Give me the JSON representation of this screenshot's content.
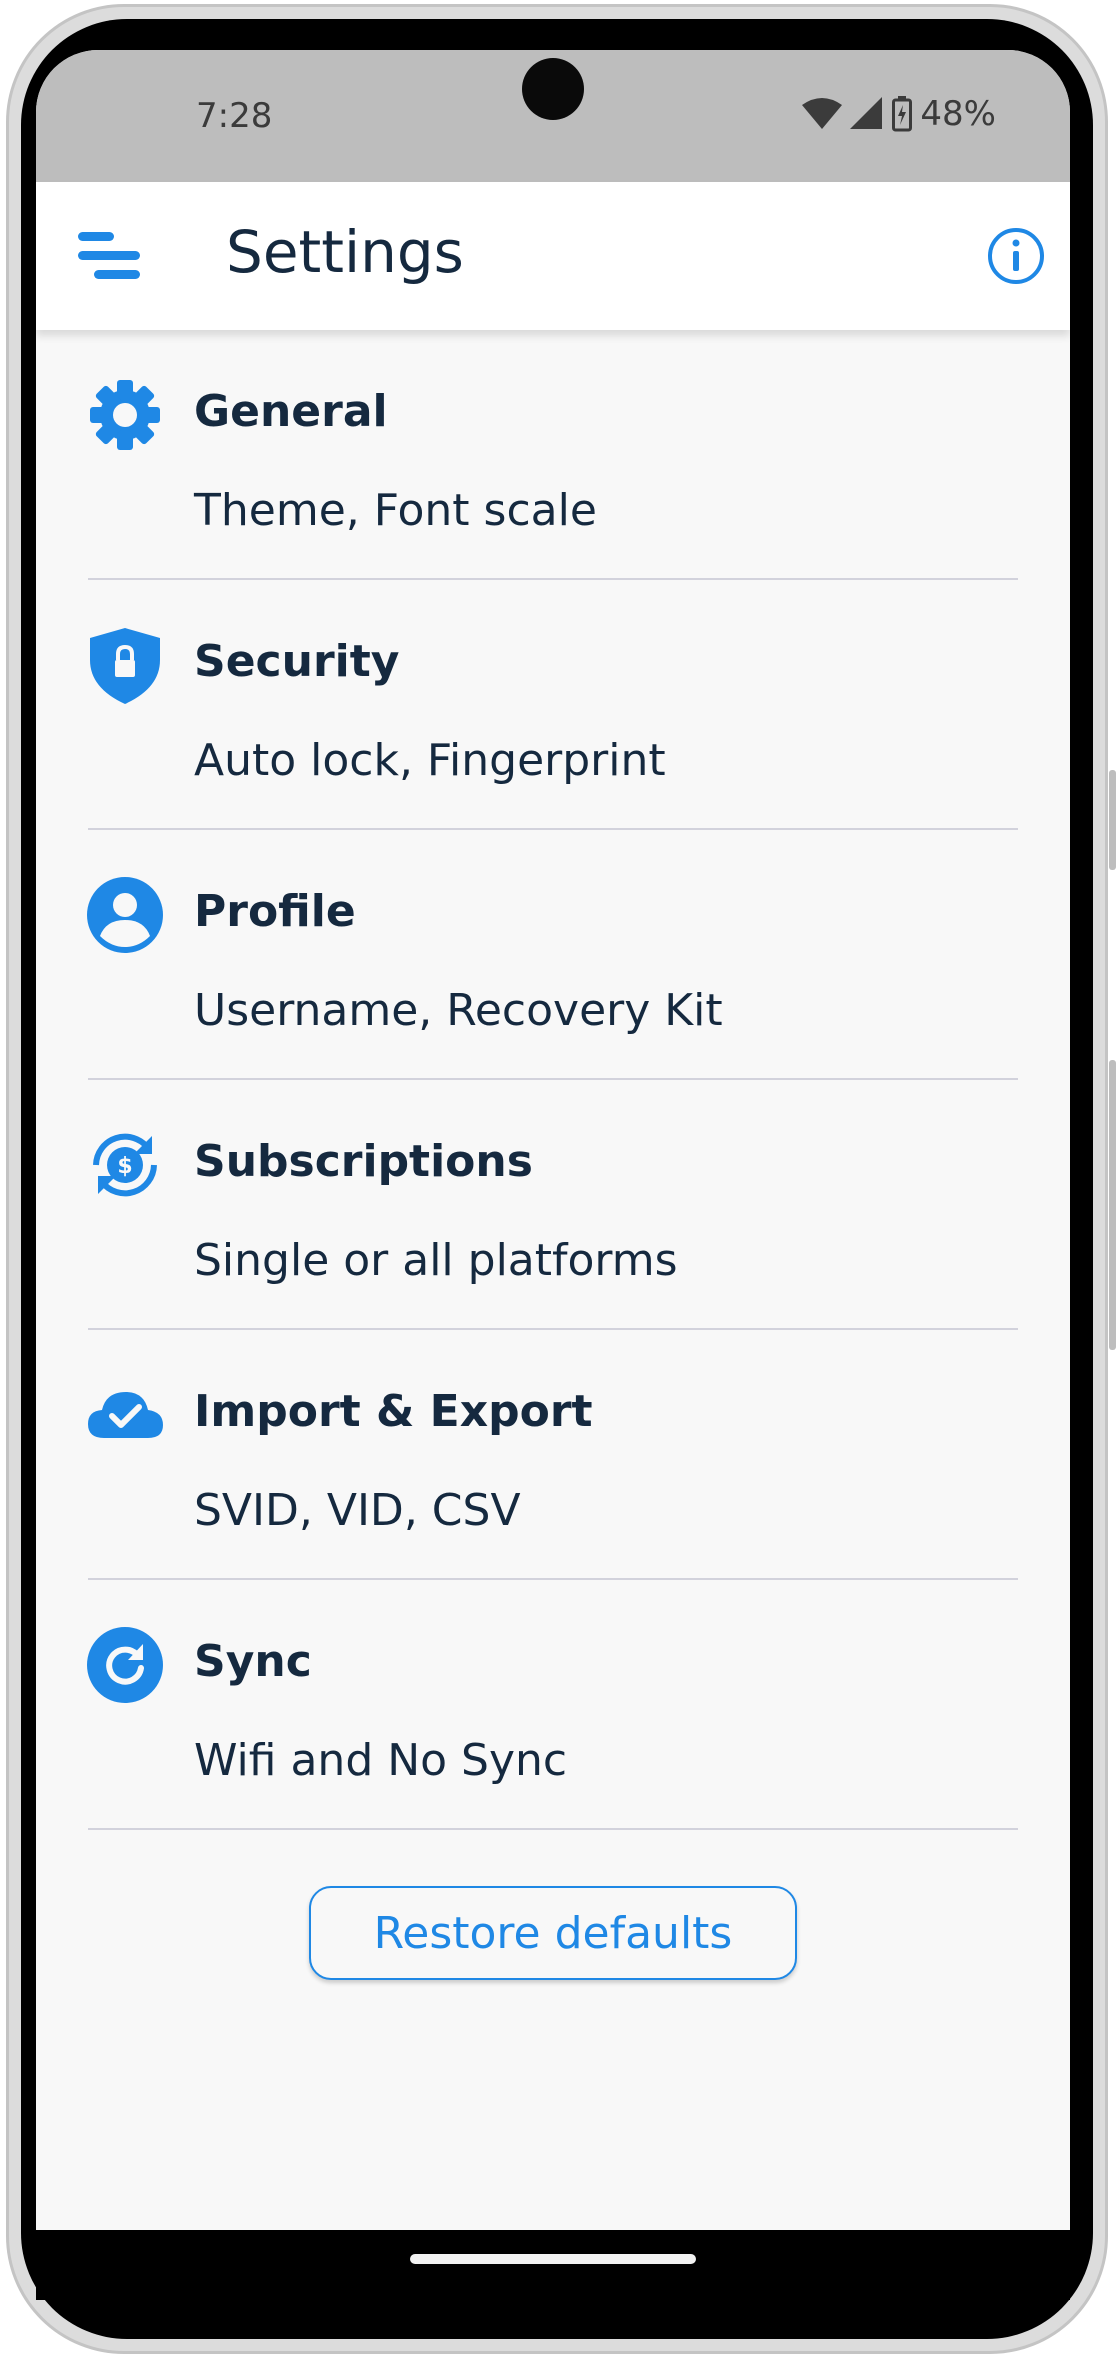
{
  "status_bar": {
    "time": "7:28",
    "battery": "48%",
    "icons": [
      "wifi-icon",
      "signal-icon",
      "battery-icon"
    ]
  },
  "app_bar": {
    "title": "Settings",
    "menu_icon": "menu-icon",
    "info_icon": "info-icon"
  },
  "colors": {
    "accent": "#1f88e5",
    "text": "#15293f",
    "status_bar_bg": "#bdbdbd",
    "background": "#f8f8f8"
  },
  "settings": [
    {
      "icon": "gear-icon",
      "title": "General",
      "subtitle": "Theme, Font scale"
    },
    {
      "icon": "shield-lock-icon",
      "title": "Security",
      "subtitle": "Auto lock, Fingerprint"
    },
    {
      "icon": "account-circle-icon",
      "title": "Profile",
      "subtitle": "Username, Recovery Kit"
    },
    {
      "icon": "subscription-refresh-icon",
      "title": "Subscriptions",
      "subtitle": "Single or all platforms"
    },
    {
      "icon": "cloud-check-icon",
      "title": "Import & Export",
      "subtitle": "SVID, VID, CSV"
    },
    {
      "icon": "sync-icon",
      "title": "Sync",
      "subtitle": "Wifi and No Sync"
    }
  ],
  "restore_button": {
    "label": "Restore defaults"
  }
}
